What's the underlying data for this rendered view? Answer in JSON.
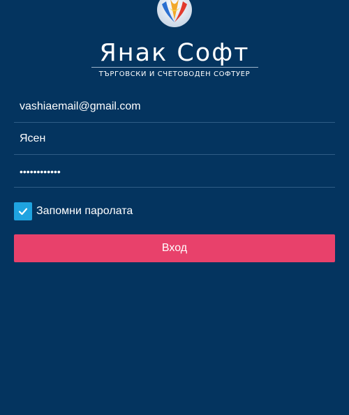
{
  "brand": {
    "title": "Янак Софт",
    "subtitle": "ТЪРГОВСКИ И СЧЕТОВОДЕН СОФТУЕР",
    "emblem_icon": "yanak-soft-logo-icon"
  },
  "form": {
    "email_value": "vashiaemail@gmail.com",
    "name_value": "Ясен",
    "password_value": "••••••••••••",
    "remember_label": "Запомни паролата",
    "remember_checked": true,
    "login_label": "Вход"
  },
  "colors": {
    "background": "#04345f",
    "divider": "#2f5d86",
    "checkbox": "#1fa3e0",
    "login_button": "#e8416b"
  }
}
